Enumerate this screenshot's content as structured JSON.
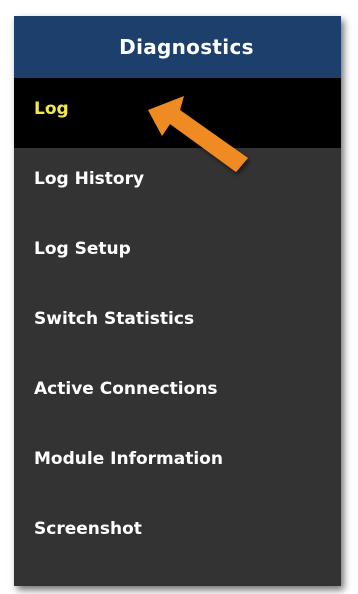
{
  "panel": {
    "title": "Diagnostics",
    "header_color": "#1d3f6c",
    "background_color": "#333333",
    "active_color": "#f4e94b"
  },
  "menu": {
    "items": [
      {
        "label": "Log",
        "active": true
      },
      {
        "label": "Log History",
        "active": false
      },
      {
        "label": "Log Setup",
        "active": false
      },
      {
        "label": "Switch Statistics",
        "active": false
      },
      {
        "label": "Active Connections",
        "active": false
      },
      {
        "label": "Module Information",
        "active": false
      },
      {
        "label": "Screenshot",
        "active": false
      }
    ]
  },
  "annotation": {
    "icon": "orange-arrow-icon",
    "color": "#f08a24"
  }
}
